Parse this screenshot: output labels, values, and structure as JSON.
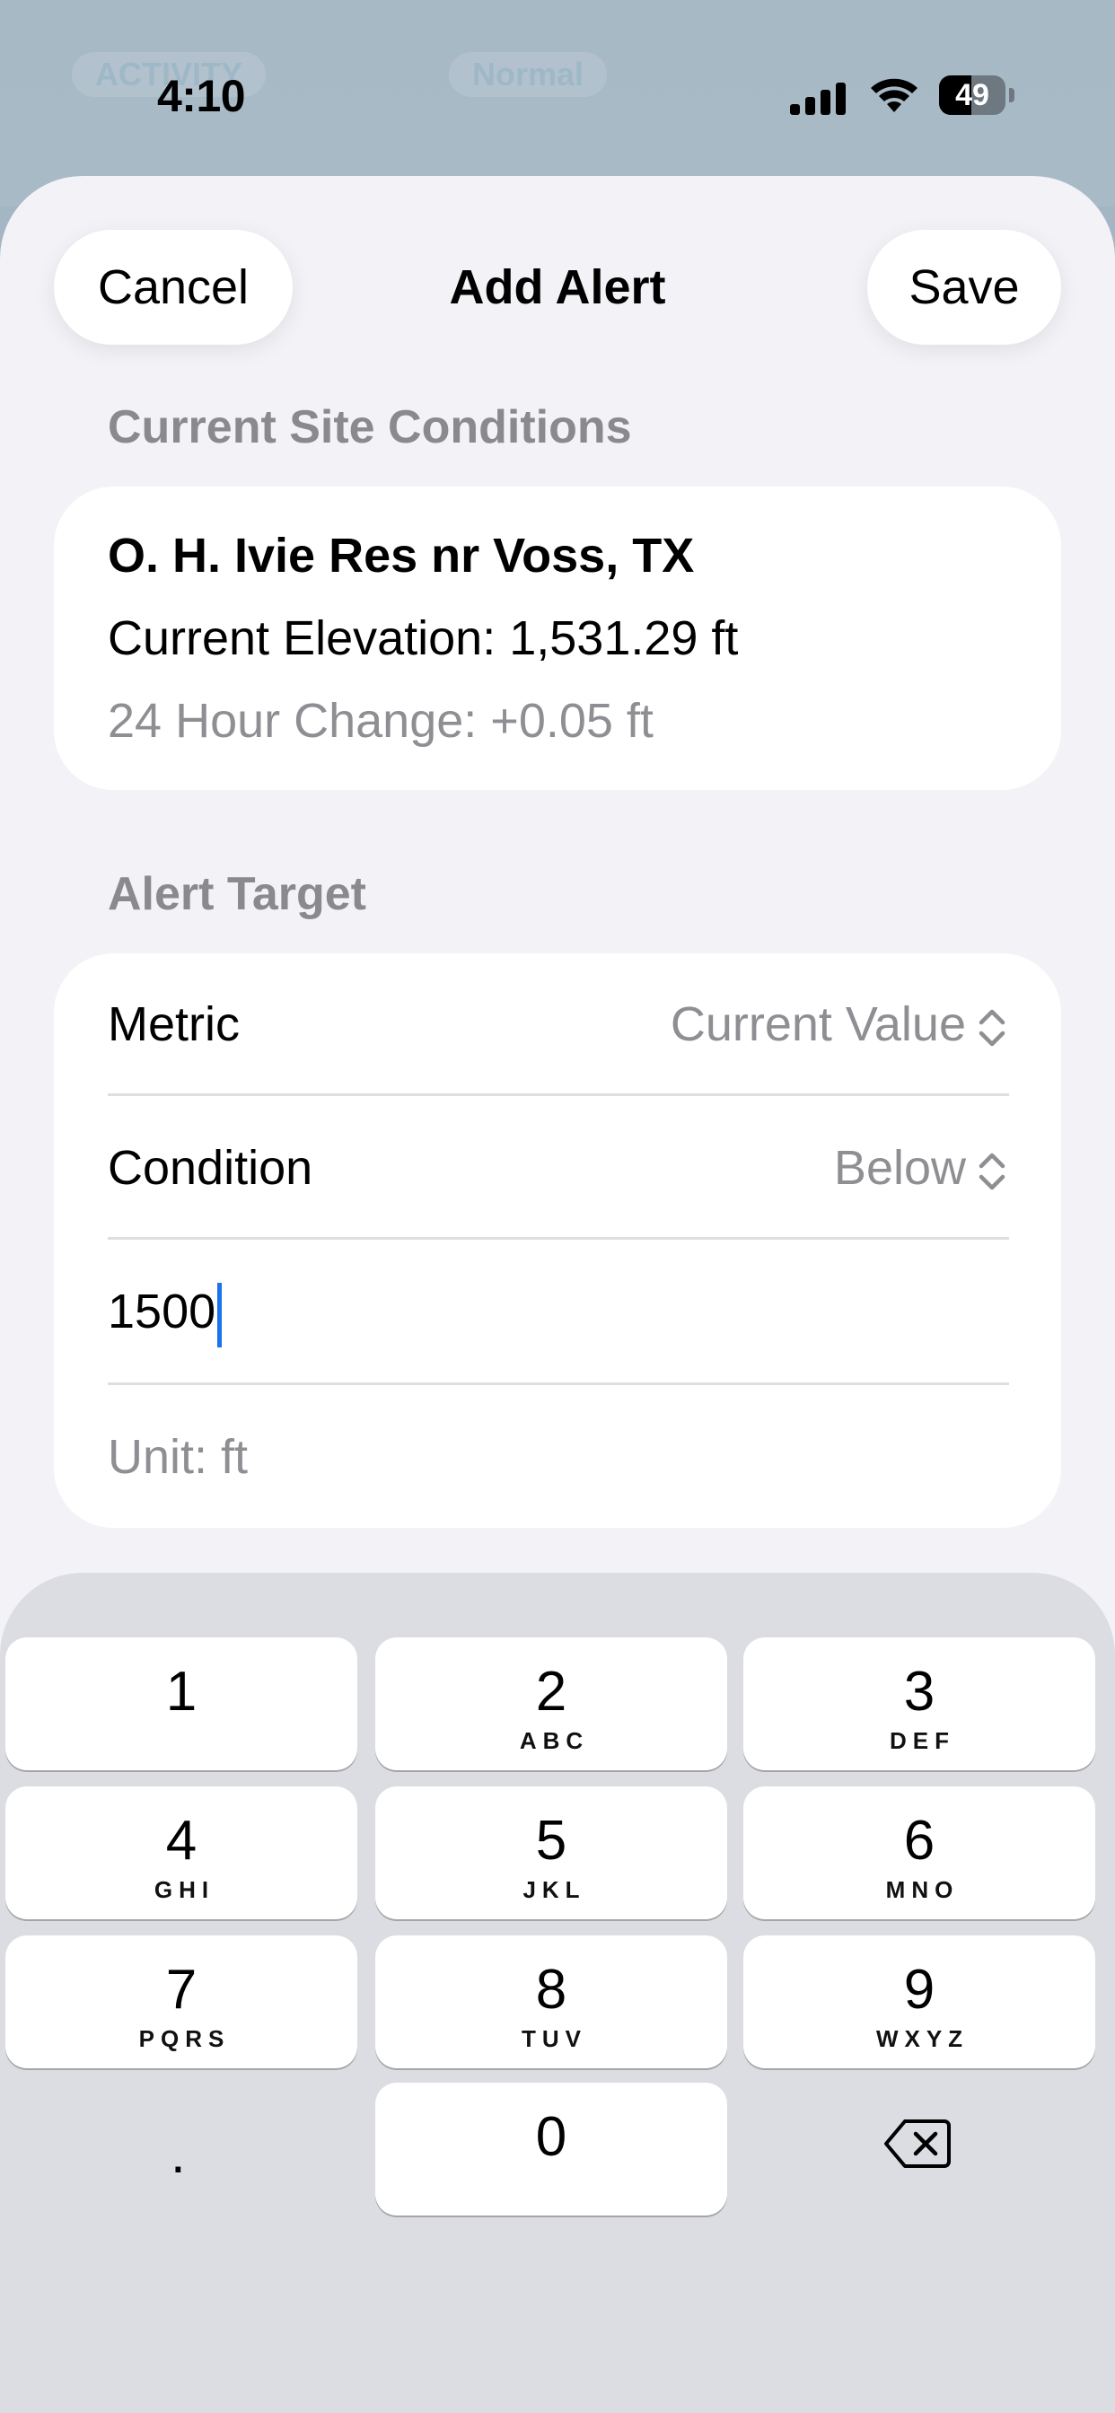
{
  "status_bar": {
    "time": "4:10",
    "battery": "49"
  },
  "background": {
    "ghost_left": "ACTIVITY",
    "ghost_right": "Normal"
  },
  "nav": {
    "cancel": "Cancel",
    "title": "Add Alert",
    "save": "Save"
  },
  "site": {
    "header": "Current Site Conditions",
    "name": "O. H. Ivie Res nr Voss, TX",
    "elevation": "Current Elevation: 1,531.29 ft",
    "change": "24 Hour Change: +0.05 ft"
  },
  "alert": {
    "header": "Alert Target",
    "metric_label": "Metric",
    "metric_value": "Current Value",
    "condition_label": "Condition",
    "condition_value": "Below",
    "threshold": "1500",
    "unit": "Unit: ft"
  },
  "keypad": {
    "keys": [
      {
        "digit": "1",
        "letters": ""
      },
      {
        "digit": "2",
        "letters": "ABC"
      },
      {
        "digit": "3",
        "letters": "DEF"
      },
      {
        "digit": "4",
        "letters": "GHI"
      },
      {
        "digit": "5",
        "letters": "JKL"
      },
      {
        "digit": "6",
        "letters": "MNO"
      },
      {
        "digit": "7",
        "letters": "PQRS"
      },
      {
        "digit": "8",
        "letters": "TUV"
      },
      {
        "digit": "9",
        "letters": "WXYZ"
      },
      {
        "digit": "0",
        "letters": ""
      }
    ],
    "decimal": "."
  },
  "colors": {
    "accent": "#1a73e8",
    "sheet": "#f2f2f7",
    "secondary_text": "#8e8e93"
  }
}
